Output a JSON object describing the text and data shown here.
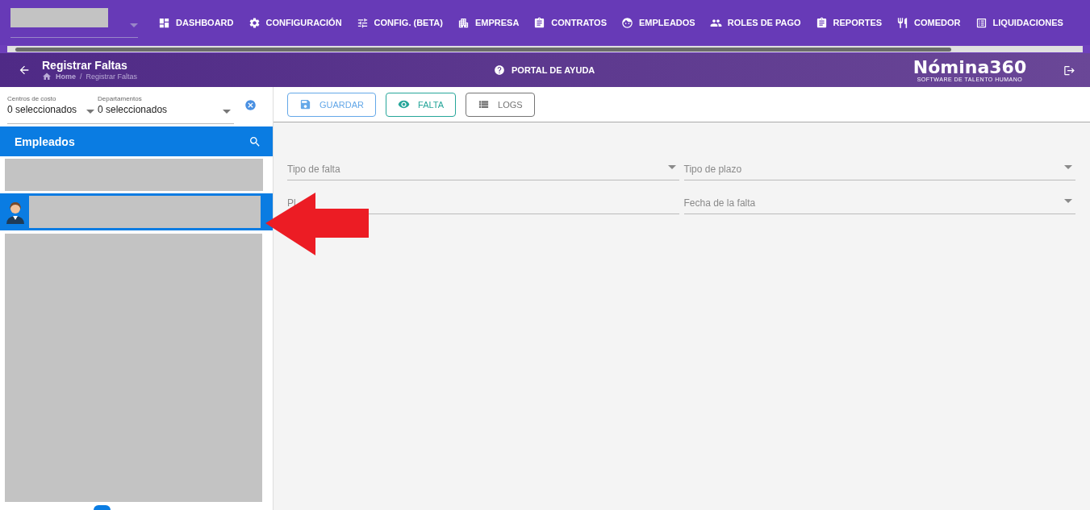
{
  "top_nav": {
    "items": [
      {
        "label": "DASHBOARD"
      },
      {
        "label": "CONFIGURACIÓN"
      },
      {
        "label": "CONFIG. (BETA)"
      },
      {
        "label": "EMPRESA"
      },
      {
        "label": "CONTRATOS"
      },
      {
        "label": "EMPLEADOS"
      },
      {
        "label": "ROLES DE PAGO"
      },
      {
        "label": "REPORTES"
      },
      {
        "label": "COMEDOR"
      },
      {
        "label": "LIQUIDACIONES"
      }
    ]
  },
  "header": {
    "title": "Registrar Faltas",
    "breadcrumbs": [
      "Home",
      "Registrar Faltas"
    ],
    "separator": "/",
    "help": "PORTAL DE AYUDA",
    "logo": "Nómina360",
    "tagline": "SOFTWARE DE TALENTO HUMANO"
  },
  "filters": [
    {
      "label": "Centros de costo",
      "value": "0 seleccionados"
    },
    {
      "label": "Departamentos",
      "value": "0 seleccionados"
    }
  ],
  "employees": {
    "title": "Empleados",
    "items": [
      {
        "selected": false,
        "avatar": false
      },
      {
        "selected": true,
        "avatar": true
      }
    ]
  },
  "toolbar": [
    {
      "label": "GUARDAR",
      "kind": "save"
    },
    {
      "label": "FALTA",
      "kind": "view"
    },
    {
      "label": "LOGS",
      "kind": "logs"
    }
  ],
  "form": [
    {
      "label": "Tipo de falta",
      "dropdown": true
    },
    {
      "label": "Tipo de plazo",
      "dropdown": true
    },
    {
      "label": "Pl",
      "dropdown": false
    },
    {
      "label": "Fecha de la falta",
      "dropdown": true
    }
  ]
}
